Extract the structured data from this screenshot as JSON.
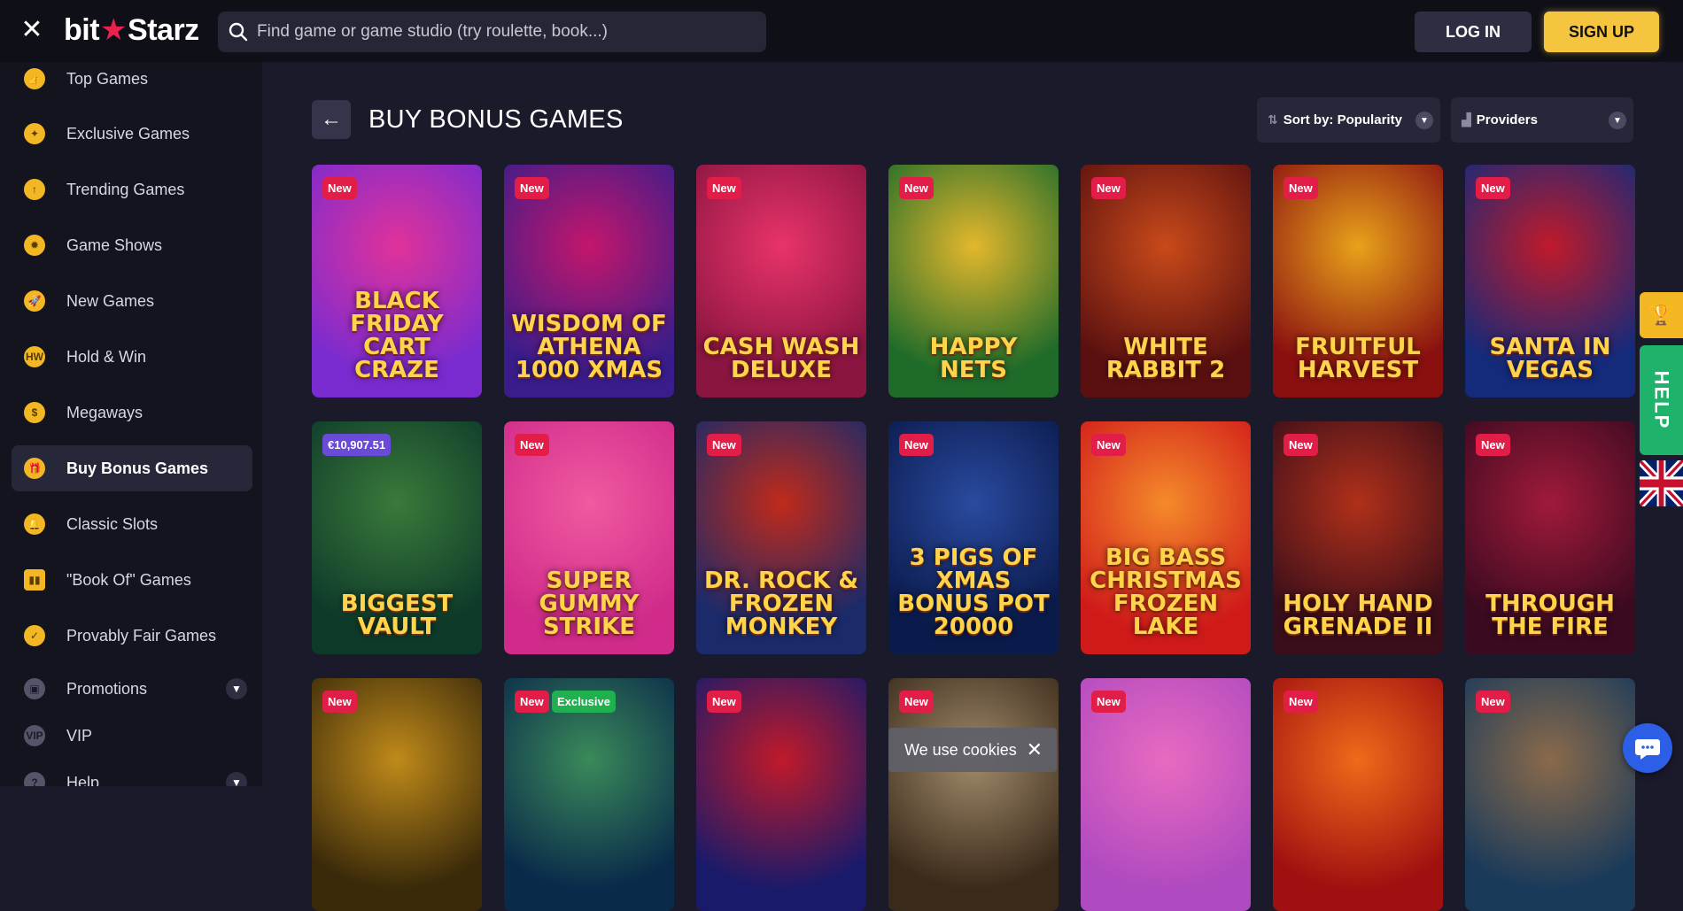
{
  "header": {
    "close_icon": "close-icon",
    "logo_left": "bit",
    "logo_star": "★",
    "logo_right": "Starz",
    "search_placeholder": "Find game or game studio (try roulette, book...)",
    "login_label": "LOG IN",
    "signup_label": "SIGN UP"
  },
  "sidebar": {
    "items": [
      {
        "label": "Top Games",
        "icon": "thumbs-up-icon",
        "glyph": "👍"
      },
      {
        "label": "Exclusive Games",
        "icon": "medal-icon",
        "glyph": "✦"
      },
      {
        "label": "Trending Games",
        "icon": "trending-up-icon",
        "glyph": "↑"
      },
      {
        "label": "Game Shows",
        "icon": "wheel-icon",
        "glyph": "✹"
      },
      {
        "label": "New Games",
        "icon": "rocket-icon",
        "glyph": "🚀"
      },
      {
        "label": "Hold & Win",
        "icon": "hold-win-icon",
        "glyph": "HW"
      },
      {
        "label": "Megaways",
        "icon": "money-bag-icon",
        "glyph": "$"
      },
      {
        "label": "Buy Bonus Games",
        "icon": "gift-icon",
        "glyph": "🎁"
      },
      {
        "label": "Classic Slots",
        "icon": "bell-icon",
        "glyph": "🔔"
      },
      {
        "label": "\"Book Of\" Games",
        "icon": "book-icon",
        "glyph": "▮▮"
      },
      {
        "label": "Provably Fair Games",
        "icon": "shield-check-icon",
        "glyph": "✓"
      },
      {
        "label": "Promotions",
        "icon": "gift-box-icon",
        "glyph": "▣"
      },
      {
        "label": "VIP",
        "icon": "vip-icon",
        "glyph": "VIP"
      },
      {
        "label": "Help",
        "icon": "question-icon",
        "glyph": "?"
      }
    ],
    "active_index": 7,
    "expand_icon": "chevron-down-icon"
  },
  "main": {
    "back_icon": "arrow-left-icon",
    "title": "BUY BONUS GAMES",
    "sort_label": "Sort by: Popularity",
    "providers_label": "Providers"
  },
  "games": [
    {
      "name": "Black Friday Cart Craze",
      "badge": "New",
      "colors": [
        "#7a2bd0",
        "#e0329a"
      ]
    },
    {
      "name": "Wisdom of Athena 1000 Xmas",
      "badge": "New",
      "colors": [
        "#3a1d8a",
        "#c4166c"
      ]
    },
    {
      "name": "Cash Wash Deluxe",
      "badge": "New",
      "colors": [
        "#8a1540",
        "#e8336a"
      ]
    },
    {
      "name": "Happy Nets",
      "badge": "New",
      "colors": [
        "#1f6b2a",
        "#e4b72c"
      ]
    },
    {
      "name": "White Rabbit 2",
      "badge": "New",
      "colors": [
        "#5a1010",
        "#c84a1a"
      ]
    },
    {
      "name": "Fruitful Harvest",
      "badge": "New",
      "colors": [
        "#8a1010",
        "#e8a21a"
      ]
    },
    {
      "name": "Santa in Vegas",
      "badge": "New",
      "colors": [
        "#142a7a",
        "#c01a2a"
      ]
    },
    {
      "name": "Biggest Vault",
      "badge": "€10,907.51",
      "badge_type": "jackpot",
      "colors": [
        "#0e3a2a",
        "#3a7a3a"
      ]
    },
    {
      "name": "Super Gummy Strike",
      "badge": "New",
      "colors": [
        "#d02a8a",
        "#f05aa0"
      ]
    },
    {
      "name": "Dr. Rock & Frozen Monkey",
      "badge": "New",
      "colors": [
        "#1a2a6a",
        "#c02a1a"
      ]
    },
    {
      "name": "3 Pigs of Xmas Bonus Pot 20000",
      "badge": "New",
      "colors": [
        "#0a1a4a",
        "#2a4aa0"
      ]
    },
    {
      "name": "Big Bass Christmas Frozen Lake",
      "badge": "New",
      "colors": [
        "#d01a1a",
        "#f58a2a"
      ]
    },
    {
      "name": "Holy Hand Grenade II",
      "badge": "New",
      "colors": [
        "#3a0e1a",
        "#b0301a"
      ]
    },
    {
      "name": "Through the Fire",
      "badge": "New",
      "colors": [
        "#3a0a20",
        "#a01a3a"
      ]
    },
    {
      "name": "",
      "badge": "New",
      "colors": [
        "#3a2a0a",
        "#c08a1a"
      ]
    },
    {
      "name": "",
      "badge": "New",
      "badge2": "Exclusive",
      "colors": [
        "#0a2a4a",
        "#3a8a5a"
      ]
    },
    {
      "name": "",
      "badge": "New",
      "colors": [
        "#1a1a6a",
        "#c01a2a"
      ]
    },
    {
      "name": "",
      "badge": "New",
      "colors": [
        "#3a2a1a",
        "#a08a6a"
      ]
    },
    {
      "name": "",
      "badge": "New",
      "colors": [
        "#b04ac0",
        "#e86ac0"
      ]
    },
    {
      "name": "",
      "badge": "New",
      "colors": [
        "#a01010",
        "#f06a1a"
      ]
    },
    {
      "name": "",
      "badge": "New",
      "colors": [
        "#1a3a5a",
        "#8a6a4a"
      ]
    }
  ],
  "cookie": {
    "text": "We use cookies",
    "close": "✕"
  },
  "right_rail": {
    "trophy_icon": "trophy-icon",
    "help_label": "HELP",
    "flag_icon": "uk-flag-icon",
    "chat_icon": "chat-icon"
  }
}
